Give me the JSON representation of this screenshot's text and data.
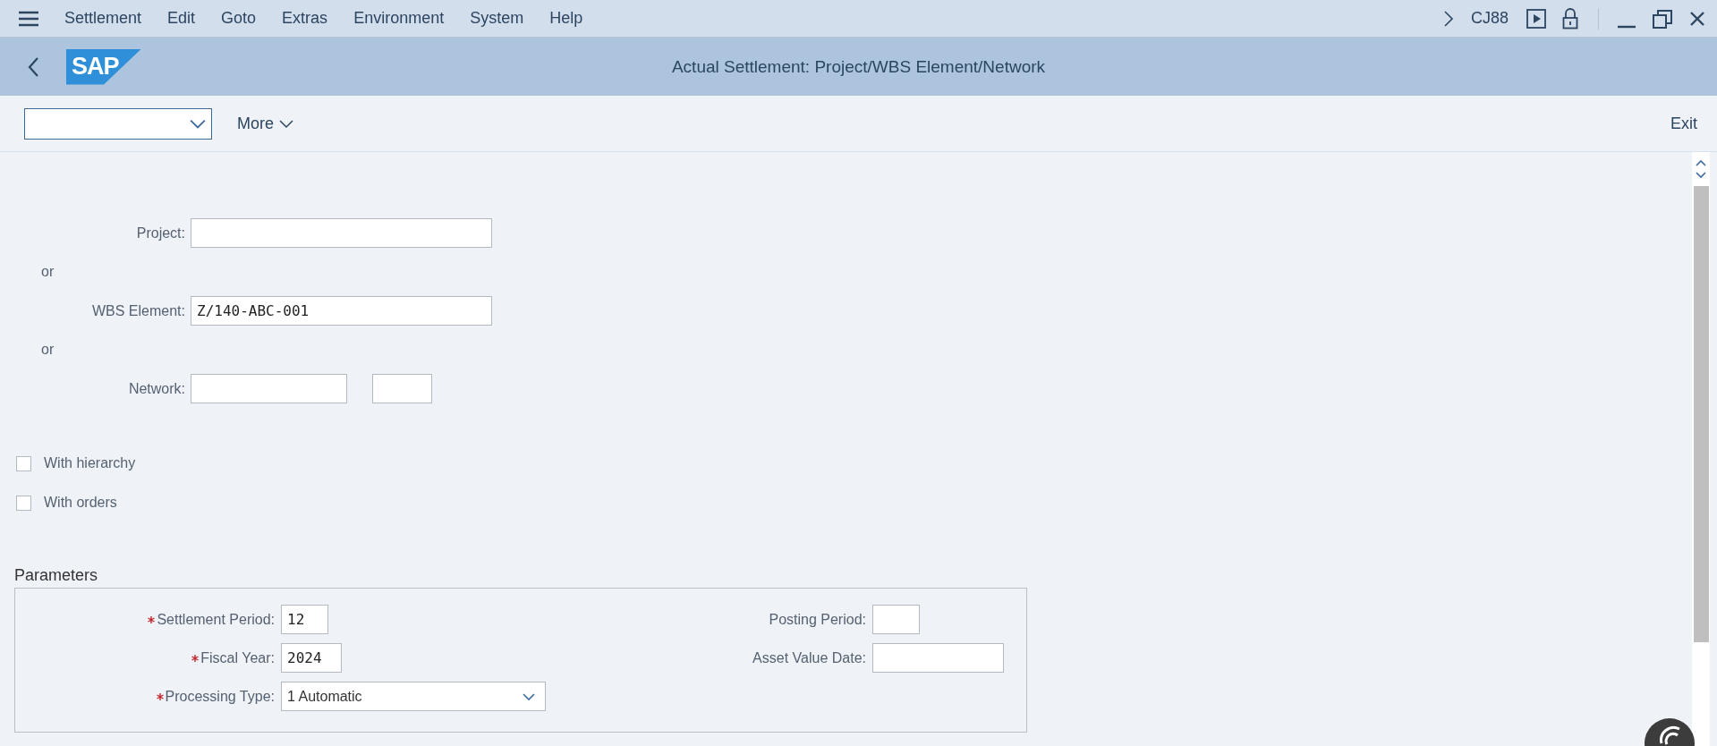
{
  "menu_bar": {
    "items": [
      "Settlement",
      "Edit",
      "Goto",
      "Extras",
      "Environment",
      "System",
      "Help"
    ],
    "transaction_code": "CJ88"
  },
  "header": {
    "logo": "SAP",
    "title": "Actual Settlement: Project/WBS Element/Network"
  },
  "toolbar": {
    "more": "More",
    "exit": "Exit"
  },
  "selection": [
    {
      "kind": "field",
      "label": "Project:"
    },
    {
      "kind": "or",
      "text": "or"
    },
    {
      "kind": "field",
      "label": "WBS Element:",
      "value": "Z/140-ABC-001"
    },
    {
      "kind": "or",
      "text": "or"
    },
    {
      "kind": "split",
      "label": "Network:"
    }
  ],
  "checkboxes": [
    {
      "label": "With hierarchy",
      "checked": false
    },
    {
      "label": "With orders",
      "checked": false
    }
  ],
  "parameters": {
    "title": "Parameters",
    "left": [
      {
        "kind": "short",
        "label": "Settlement Period:",
        "required": true,
        "value": "12"
      },
      {
        "kind": "medium",
        "label": "Fiscal Year:",
        "required": true,
        "value": "2024"
      },
      {
        "kind": "dropdown",
        "label": "Processing Type:",
        "required": true,
        "value": "1 Automatic"
      }
    ],
    "right": [
      {
        "kind": "short",
        "label": "Posting Period:",
        "required": false
      },
      {
        "kind": "long",
        "label": "Asset Value Date:",
        "required": false
      }
    ]
  }
}
